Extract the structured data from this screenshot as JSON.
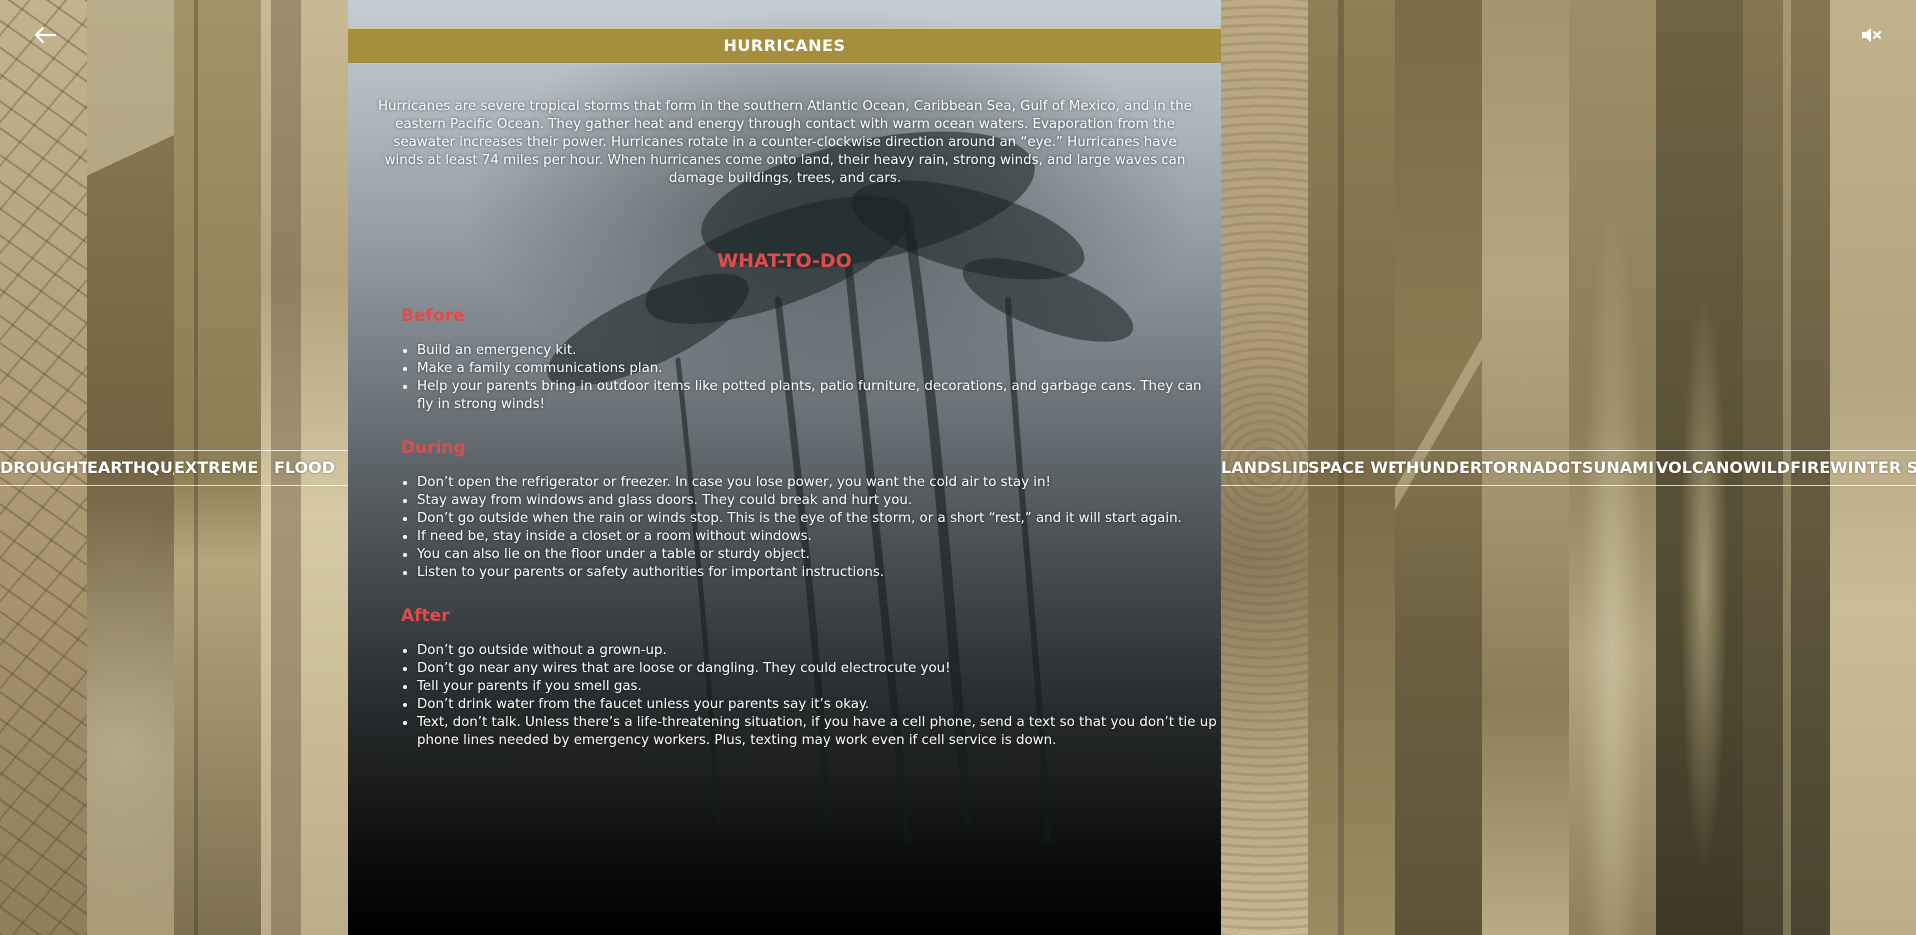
{
  "header": {
    "back_icon": "arrow-left-icon",
    "mute_icon": "speaker-muted-icon"
  },
  "strips_left": [
    {
      "label": "DROUGHT",
      "color": "#b2a37c"
    },
    {
      "label": "EARTHQU/",
      "color": "#8c7c55"
    },
    {
      "label": "EXTREME H",
      "color": "#9c8f64"
    },
    {
      "label": "FLOOD",
      "color": "#c8b995"
    }
  ],
  "strips_right": [
    {
      "label": "LANDSLID",
      "color": "#b6a57c"
    },
    {
      "label": "SPACE WE/",
      "color": "#8e7f56"
    },
    {
      "label": "THUNDERS",
      "color": "#857650"
    },
    {
      "label": "TORNADO",
      "color": "#a09069"
    },
    {
      "label": "TSUNAMI",
      "color": "#998a63"
    },
    {
      "label": "VOLCANO",
      "color": "#6f6443"
    },
    {
      "label": "WILDFIRE",
      "color": "#7d6f4a"
    },
    {
      "label": "WINTER ST",
      "color": "#c4b692"
    }
  ],
  "panel": {
    "title": "HURRICANES",
    "intro": "Hurricanes are severe tropical storms that form in the southern Atlantic Ocean, Caribbean Sea, Gulf of Mexico, and in the eastern Pacific Ocean. They gather heat and energy through contact with warm ocean waters. Evaporation from the seawater increases their power. Hurricanes rotate in a counter-clockwise direction around an “eye.” Hurricanes have winds at least 74 miles per hour. When hurricanes come onto land, their heavy rain, strong winds, and large waves can damage buildings, trees, and cars.",
    "what_to_do": "WHAT-TO-DO",
    "before": {
      "title": "Before",
      "items": [
        "Build an emergency kit.",
        "Make a family communications plan.",
        "Help your parents bring in outdoor items like potted plants, patio furniture, decorations, and garbage cans. They can fly in strong winds!"
      ]
    },
    "during": {
      "title": "During",
      "items": [
        "Don’t open the refrigerator or freezer. In case you lose power, you want the cold air to stay in!",
        "Stay away from windows and glass doors. They could break and hurt you.",
        "Don’t go outside when the rain or winds stop. This is the eye of the storm, or a short “rest,” and it will start again.",
        "If need be, stay inside a closet or a room without windows.",
        "You can also lie on the floor under a table or sturdy object.",
        "Listen to your parents or safety authorities for important instructions."
      ]
    },
    "after": {
      "title": "After",
      "items": [
        "Don’t go outside without a grown-up.",
        "Don’t go near any wires that are loose or dangling. They could electrocute you!",
        "Tell your parents if you smell gas.",
        "Don’t drink water from the faucet unless your parents say it’s okay.",
        "Text, don’t talk. Unless there’s a life-threatening situation, if you have a cell phone, send a text so that you don’t tie up phone lines needed by emergency workers. Plus, texting may work even if cell service is down."
      ]
    }
  }
}
